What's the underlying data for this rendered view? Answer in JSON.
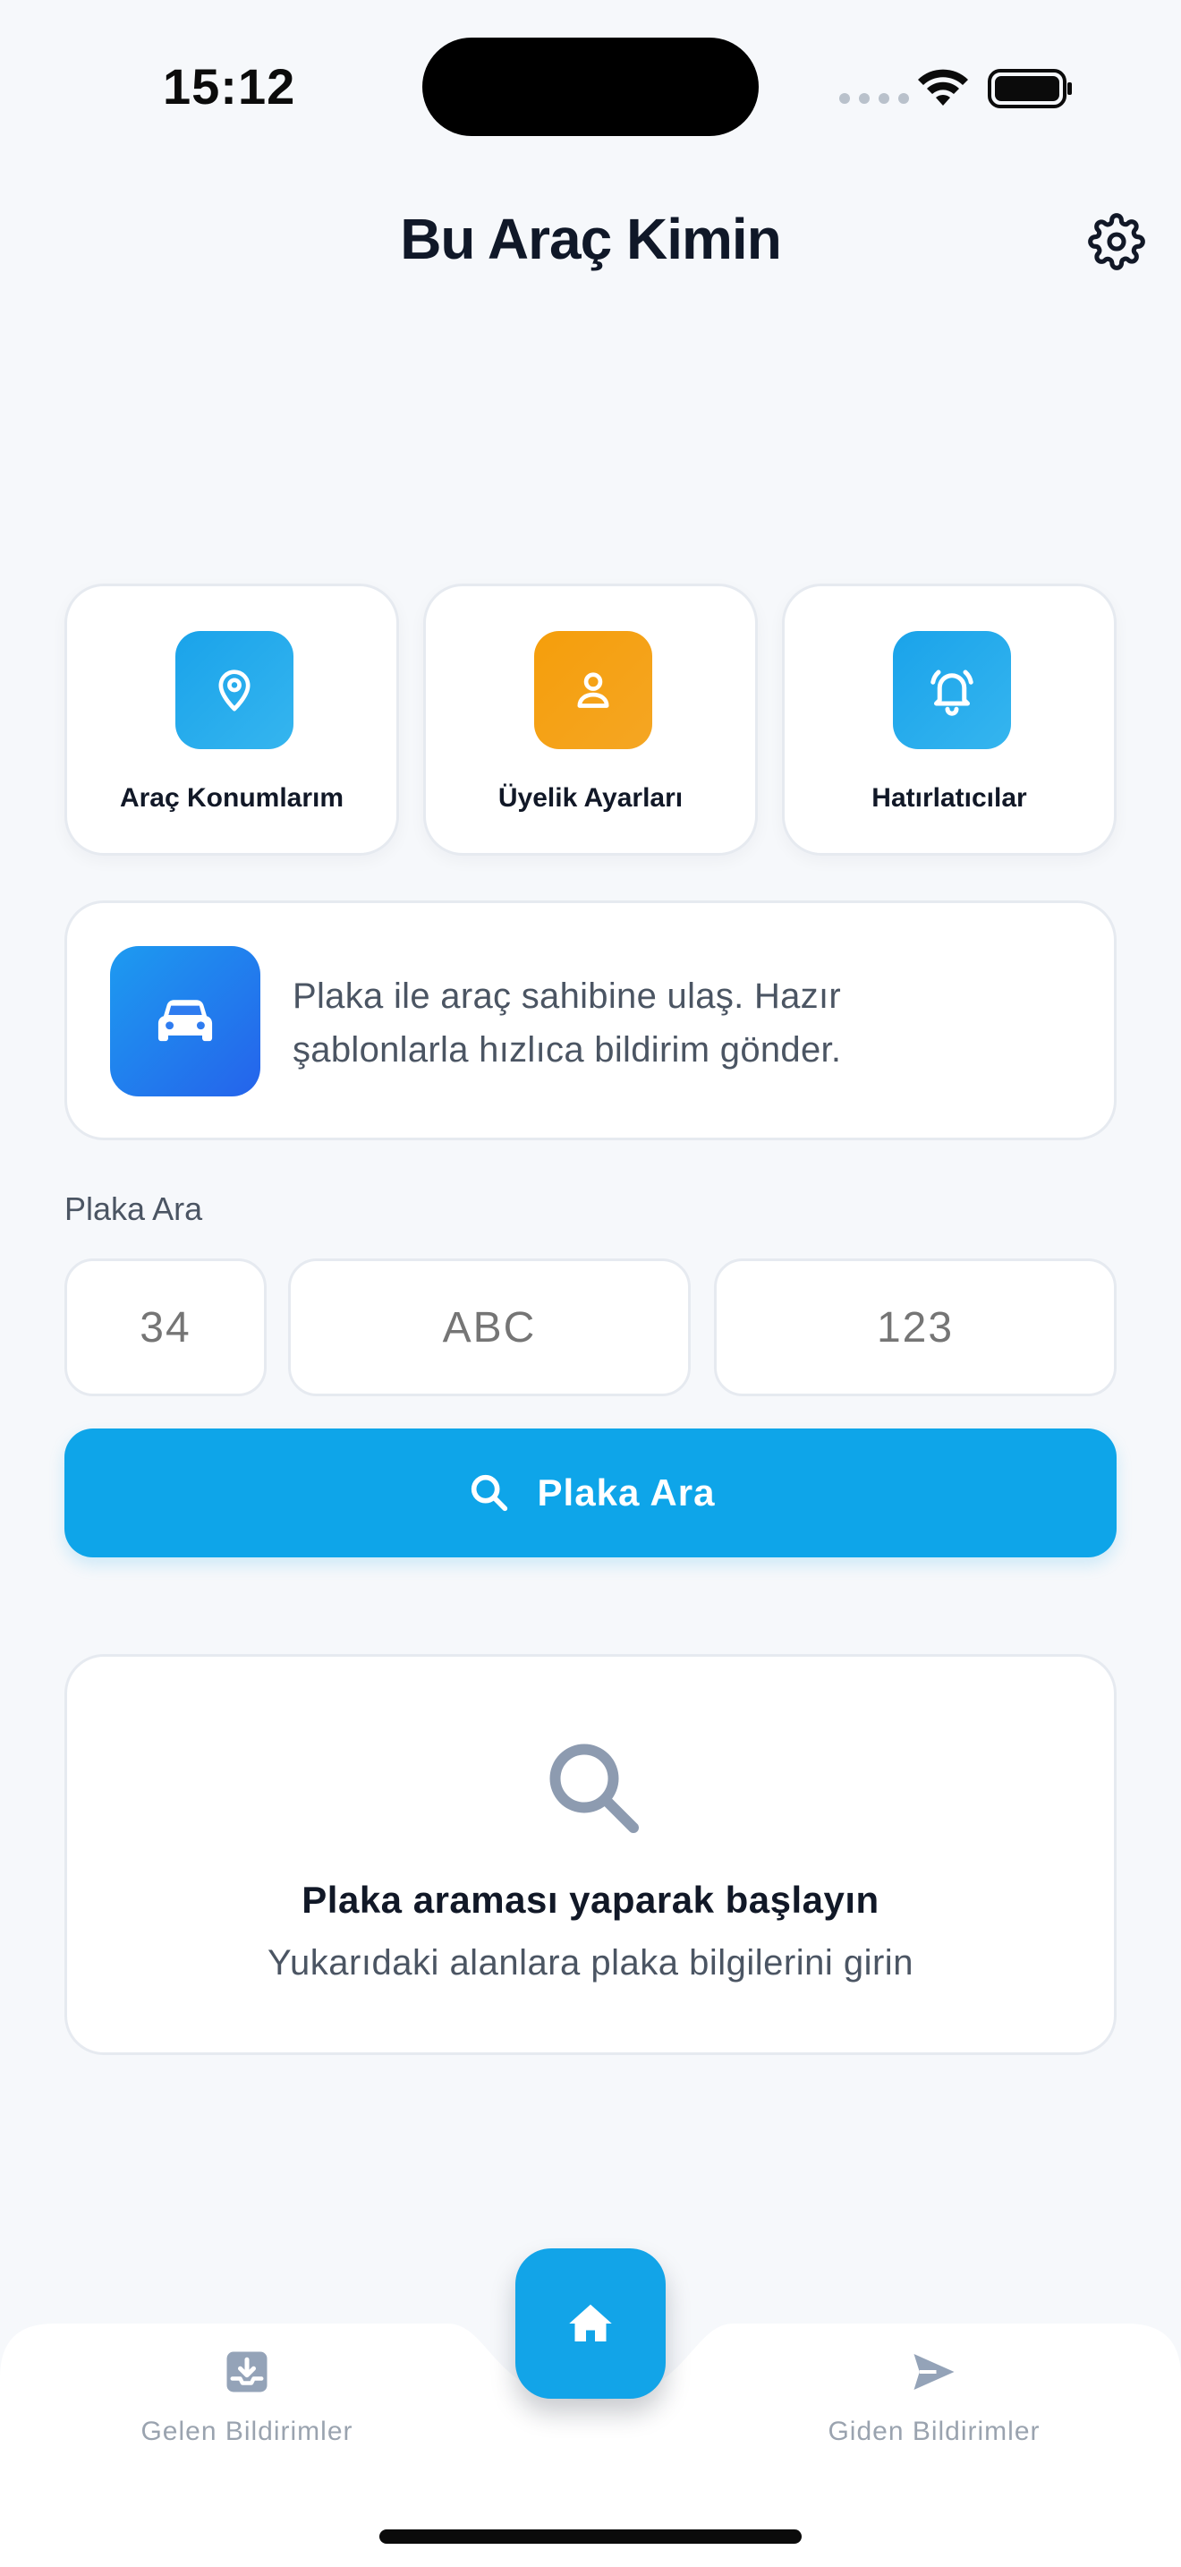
{
  "status_bar": {
    "time": "15:12"
  },
  "header": {
    "title": "Bu Araç Kimin",
    "settings_icon": "gear-icon"
  },
  "quick_actions": [
    {
      "label": "Araç Konumlarım",
      "icon": "location-pin-icon",
      "color": "#1aa3ea"
    },
    {
      "label": "Üyelik Ayarları",
      "icon": "user-icon",
      "color": "#f59e0b"
    },
    {
      "label": "Hatırlatıcılar",
      "icon": "bell-icon",
      "color": "#1aa3ea"
    }
  ],
  "info_banner": {
    "icon": "car-icon",
    "line1": "Plaka ile araç sahibine ulaş. Hazır",
    "line2": "şablonlarla hızlıca bildirim gönder."
  },
  "plate_search": {
    "label": "Plaka Ara",
    "city_code_placeholder": "34",
    "letters_placeholder": "ABC",
    "numbers_placeholder": "123",
    "button_label": "Plaka Ara",
    "button_icon": "search-icon"
  },
  "empty_state": {
    "icon": "search-icon",
    "title": "Plaka araması yaparak başlayın",
    "subtitle": "Yukarıdaki alanlara plaka bilgilerini girin"
  },
  "bottom_nav": {
    "left": {
      "label": "Gelen Bildirimler",
      "icon": "inbox-icon"
    },
    "center": {
      "icon": "home-icon"
    },
    "right": {
      "label": "Giden Bildirimler",
      "icon": "send-icon"
    }
  },
  "colors": {
    "accent": "#0ea5e9",
    "orange": "#f59e0b",
    "background": "#f6f8fb"
  }
}
